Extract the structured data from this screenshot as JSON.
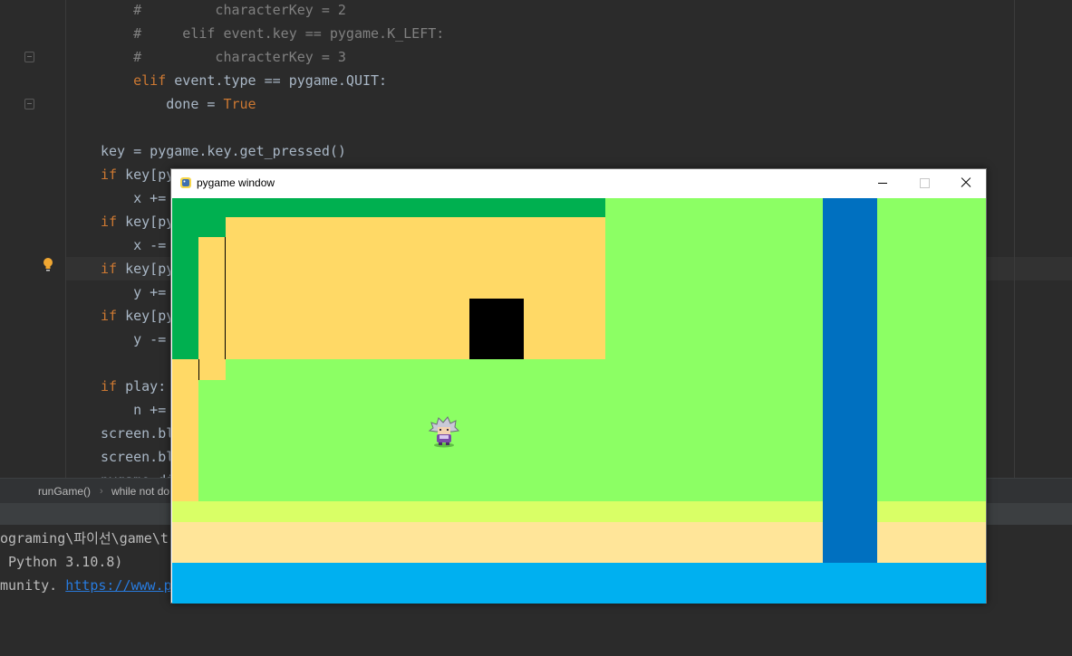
{
  "editor": {
    "lines": [
      [
        {
          "t": "    #         characterKey = 2",
          "c": "comment"
        }
      ],
      [
        {
          "t": "    #     elif event.key == pygame.K_LEFT:",
          "c": "comment"
        }
      ],
      [
        {
          "t": "    #         characterKey = 3",
          "c": "comment"
        }
      ],
      [
        {
          "t": "    ",
          "c": "plain"
        },
        {
          "t": "elif",
          "c": "kw"
        },
        {
          "t": " event.type == pygame.QUIT:",
          "c": "plain"
        }
      ],
      [
        {
          "t": "        done = ",
          "c": "plain"
        },
        {
          "t": "True",
          "c": "kw"
        }
      ],
      [
        {
          "t": "",
          "c": "plain"
        }
      ],
      [
        {
          "t": "key = pygame.key.get_pressed()",
          "c": "plain"
        }
      ],
      [
        {
          "t": "if",
          "c": "kw"
        },
        {
          "t": " key[py",
          "c": "plain"
        }
      ],
      [
        {
          "t": "    x +=",
          "c": "plain"
        }
      ],
      [
        {
          "t": "if",
          "c": "kw"
        },
        {
          "t": " key[py",
          "c": "plain"
        }
      ],
      [
        {
          "t": "    x -=",
          "c": "plain"
        }
      ],
      [
        {
          "t": "if",
          "c": "kw"
        },
        {
          "t": " key[py",
          "c": "plain"
        }
      ],
      [
        {
          "t": "    y +=",
          "c": "plain"
        }
      ],
      [
        {
          "t": "if",
          "c": "kw"
        },
        {
          "t": " key[py",
          "c": "plain"
        }
      ],
      [
        {
          "t": "    y -=",
          "c": "plain"
        }
      ],
      [
        {
          "t": "",
          "c": "plain"
        }
      ],
      [
        {
          "t": "if",
          "c": "kw"
        },
        {
          "t": " play:",
          "c": "plain"
        }
      ],
      [
        {
          "t": "    n +=",
          "c": "plain"
        }
      ],
      [
        {
          "t": "screen.bl",
          "c": "plain"
        }
      ],
      [
        {
          "t": "screen.bl",
          "c": "plain"
        }
      ],
      [
        {
          "t": "pygame.di",
          "c": "plain"
        }
      ]
    ]
  },
  "breadcrumb": {
    "item1": "runGame()",
    "item2": "while not do"
  },
  "console": {
    "line1": "ograming\\파이선\\game\\t",
    "line2": " Python 3.10.8)",
    "line3_text": "munity. ",
    "line3_link": "https://www.py"
  },
  "pygame_window": {
    "title": "pygame window",
    "icon": "pygame-snake-icon",
    "colors": {
      "grass": "#8cff64",
      "dark_green": "#00b050",
      "sand": "#ffd966",
      "light_yellow_green": "#d9ff66",
      "beige": "#ffe599",
      "river_blue": "#0070c0",
      "sea_blue": "#00b0f0",
      "door": "#000000"
    },
    "character": "player-sprite"
  }
}
